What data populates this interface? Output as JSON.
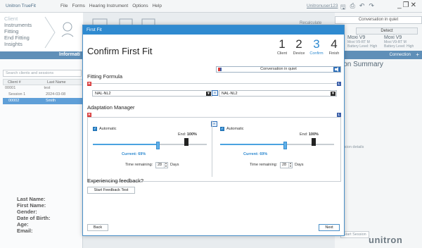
{
  "menubar": {
    "brand": "Unitron TrueFit",
    "menus": [
      "File",
      "Forms",
      "Hearing Instrument",
      "Options",
      "Help"
    ],
    "user": "Unitronuser123"
  },
  "nav": {
    "items": [
      "Client",
      "Instruments",
      "Fitting",
      "End Fitting",
      "Insights"
    ],
    "active_band": "Informati"
  },
  "left": {
    "search_placeholder": "Search clients and sessions",
    "columns": [
      "Client #",
      "Last Name"
    ],
    "rows": [
      {
        "num": "00001",
        "name": "test"
      },
      {
        "num": "Session 1",
        "name": "2024-03-08"
      },
      {
        "num": "00002",
        "name": "Smith"
      }
    ],
    "info_labels": [
      "Last Name:",
      "First Name:",
      "Gender:",
      "Date of Birth:",
      "Age:",
      "Email:"
    ]
  },
  "right": {
    "recalculate": "Recalculate",
    "program": "Conversation in quiet",
    "detect": "Detect",
    "devices": [
      {
        "name": "Moxi V9",
        "sub": "Moxi V9-RT M",
        "battery": "Battery Level: High"
      },
      {
        "name": "Moxi V9",
        "sub": "Moxi V9-RT M",
        "battery": "Battery Level: High"
      }
    ],
    "connection": "Connection",
    "summary": "ion Summary",
    "details": "ession details",
    "start_session": "Start Session",
    "logo": "unitron"
  },
  "dialog": {
    "window_title": "First Fit",
    "heading": "Confirm First Fit",
    "steps": [
      {
        "num": "1",
        "label": "Client"
      },
      {
        "num": "2",
        "label": "Device"
      },
      {
        "num": "3",
        "label": "Confirm"
      },
      {
        "num": "4",
        "label": "Finish"
      }
    ],
    "current_step": 3,
    "fitting_formula_title": "Fitting Formula",
    "program": "Conversation in quiet",
    "side_left": "R",
    "side_right": "L",
    "formula_left": "NAL-NL2",
    "formula_right": "NAL-NL2",
    "adaptation_title": "Adaptation Manager",
    "automatic_label": "Automatic",
    "end_label": "End:",
    "end_value": "100%",
    "current_label": "Current:",
    "current_value": "69%",
    "current_fraction": 0.69,
    "time_remaining_label": "Time remaining:",
    "time_remaining_value": "28",
    "days_label": "Days",
    "feedback_title": "Experiencing feedback?",
    "feedback_button": "Start Feedback Test",
    "back_button": "Back",
    "next_button": "Next"
  },
  "colors": {
    "accent": "#2f8ad0",
    "right_ear": "#d83a3a",
    "left_ear": "#3a5ea8",
    "band": "#5f8fb8"
  }
}
